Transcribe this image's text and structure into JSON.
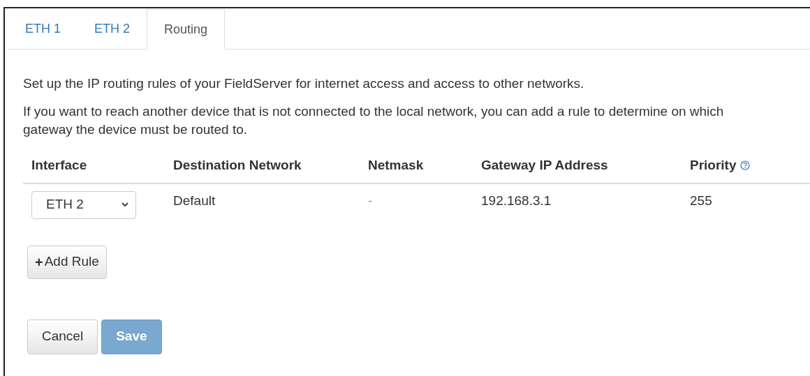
{
  "tabs": [
    {
      "label": "ETH 1",
      "selected": false
    },
    {
      "label": "ETH 2",
      "selected": false
    },
    {
      "label": "Routing",
      "selected": true
    }
  ],
  "intro": [
    "Set up the IP routing rules of your FieldServer for internet access and access to other networks.",
    "If you want to reach another device that is not connected to the local network, you can add a rule to determine on which gateway the device must be routed to."
  ],
  "table": {
    "columns": [
      {
        "label": "Interface"
      },
      {
        "label": "Destination Network"
      },
      {
        "label": "Netmask"
      },
      {
        "label": "Gateway IP Address"
      },
      {
        "label": "Priority",
        "help": true
      }
    ],
    "rows": [
      {
        "interface": "ETH 2",
        "destination": "Default",
        "netmask": "-",
        "gateway": "192.168.3.1",
        "priority": "255"
      }
    ]
  },
  "add_rule_button": {
    "icon": "+",
    "label": "Add Rule"
  },
  "buttons": [
    {
      "label": "Cancel",
      "kind": "default",
      "disabled": false
    },
    {
      "label": "Save",
      "kind": "primary",
      "disabled": true
    }
  ]
}
